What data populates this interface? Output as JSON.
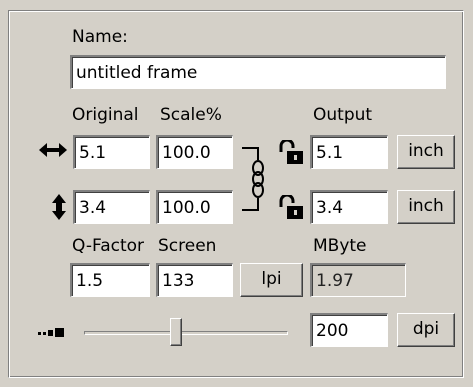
{
  "name": {
    "label": "Name:",
    "value": "untitled frame"
  },
  "columns": {
    "original": "Original",
    "scale": "Scale%",
    "output": "Output"
  },
  "width_row": {
    "original": "5.1",
    "scale": "100.0",
    "output": "5.1",
    "unit": "inch",
    "icon": "horizontal-arrows-icon"
  },
  "height_row": {
    "original": "3.4",
    "scale": "100.0",
    "output": "3.4",
    "unit": "inch",
    "icon": "vertical-arrows-icon"
  },
  "quality": {
    "qfactor_label": "Q-Factor",
    "screen_label": "Screen",
    "mbyte_label": "MByte",
    "qfactor": "1.5",
    "screen": "133",
    "screen_unit": "lpi",
    "mbyte": "1.97"
  },
  "resolution": {
    "slider_fraction": 0.45,
    "value": "200",
    "unit": "dpi"
  },
  "icons": {
    "chain": "chain-link-icon",
    "lock": "padlock-icon",
    "resolution": "resolution-icon"
  }
}
